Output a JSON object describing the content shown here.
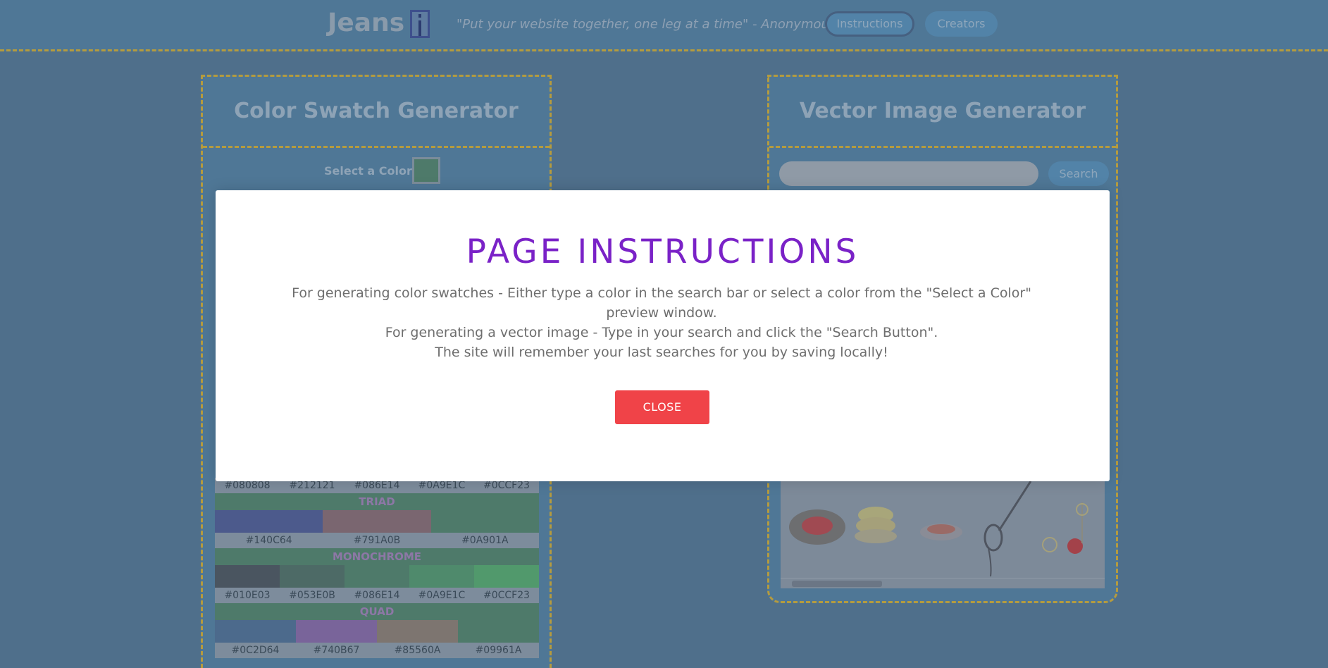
{
  "header": {
    "logo_text": "Jeans",
    "tagline": "\"Put your website together, one leg at a time\" - Anonymous",
    "nav": {
      "instructions": "Instructions",
      "creators": "Creators"
    }
  },
  "color_panel": {
    "title": "Color Swatch Generator",
    "select_label": "Select a Color:",
    "selected_color": "#4e7a6a",
    "groups": [
      {
        "name": "",
        "swatches": [
          {
            "hex": "#080808",
            "color": "#4a5560"
          },
          {
            "hex": "#212121",
            "color": "#4d5c66"
          },
          {
            "hex": "#086E14",
            "color": "#4e7a6a"
          },
          {
            "hex": "#0A9E1C",
            "color": "#4f8a6c"
          },
          {
            "hex": "#0CCF23",
            "color": "#51996c"
          }
        ]
      },
      {
        "name": "TRIAD",
        "swatches": [
          {
            "hex": "#140C64",
            "color": "#4c5a8c"
          },
          {
            "hex": "#791A0B",
            "color": "#7a6670"
          },
          {
            "hex": "#0A901A",
            "color": "#4e7a6a"
          }
        ]
      },
      {
        "name": "MONOCHROME",
        "swatches": [
          {
            "hex": "#010E03",
            "color": "#4a5560"
          },
          {
            "hex": "#053E0B",
            "color": "#4d6a66"
          },
          {
            "hex": "#086E14",
            "color": "#4e7a6a"
          },
          {
            "hex": "#0A9E1C",
            "color": "#4f8a6c"
          },
          {
            "hex": "#0CCF23",
            "color": "#51996c"
          }
        ]
      },
      {
        "name": "QUAD",
        "swatches": [
          {
            "hex": "#0C2D64",
            "color": "#4c6a8c"
          },
          {
            "hex": "#740B67",
            "color": "#79649a"
          },
          {
            "hex": "#85560A",
            "color": "#7d7570"
          },
          {
            "hex": "#09961A",
            "color": "#4e7a6a"
          }
        ]
      }
    ]
  },
  "vector_panel": {
    "title": "Vector Image Generator",
    "search_placeholder": "",
    "search_button": "Search"
  },
  "modal": {
    "title": "PAGE INSTRUCTIONS",
    "line1": "For generating color swatches - Either type a color in the search bar or select a color from the \"Select a Color\" preview window.",
    "line2": "For generating a vector image - Type in your search and click the \"Search Button\".",
    "line3": "The site will remember your last searches for you by saving locally!",
    "close_label": "CLOSE"
  }
}
